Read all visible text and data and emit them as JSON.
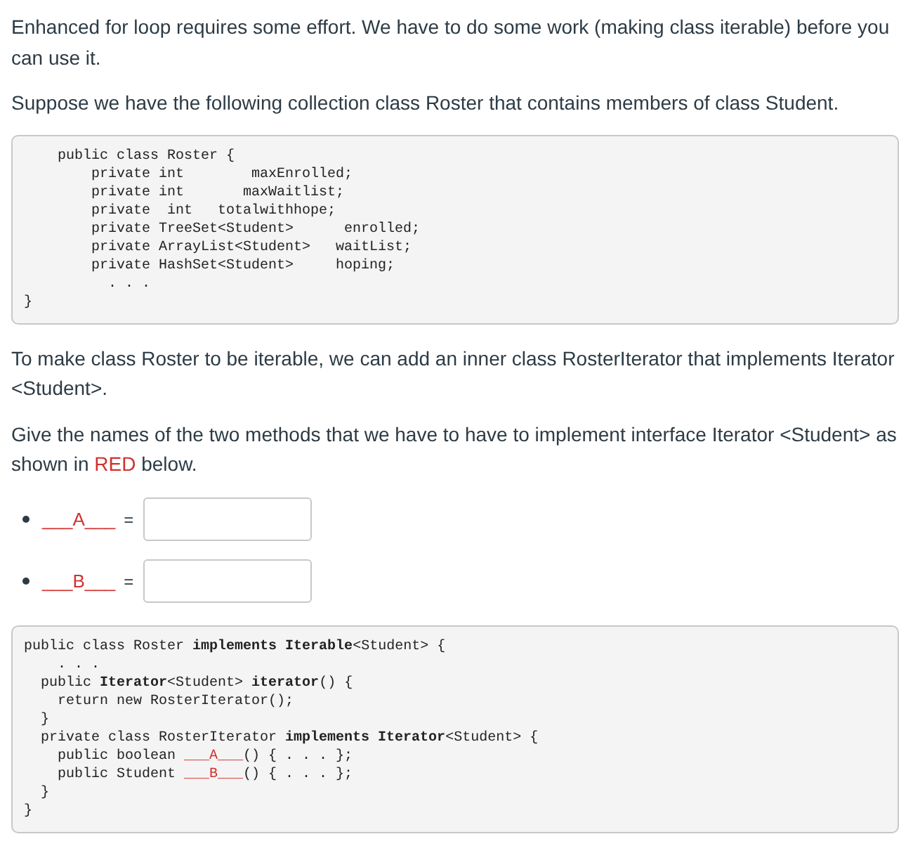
{
  "paragraphs_top": [
    [
      {
        "text": "Enhanced for loop requires some effort. We have to do some work (making class iterable) before you can use it."
      }
    ],
    [
      {
        "text": "Suppose we have the following collection class Roster that contains members of class Student."
      }
    ]
  ],
  "code_block_1": [
    [
      {
        "text": "    public class Roster {"
      }
    ],
    [
      {
        "text": "        private int        maxEnrolled;"
      }
    ],
    [
      {
        "text": "        private int       maxWaitlist;"
      }
    ],
    [
      {
        "text": "        private  int   totalwithhope;"
      }
    ],
    [
      {
        "text": "        private TreeSet<Student>      enrolled;"
      }
    ],
    [
      {
        "text": "        private ArrayList<Student>   waitList;"
      }
    ],
    [
      {
        "text": "        private HashSet<Student>     hoping;"
      }
    ],
    [
      {
        "text": "          . . ."
      }
    ],
    [
      {
        "text": "}"
      }
    ]
  ],
  "paragraphs_middle": [
    [
      {
        "text": "To make class Roster to be iterable, we can add an inner class RosterIterator that implements Iterator <Student>."
      }
    ],
    [
      {
        "text": "Give the names of the two methods that we have to have to implement interface Iterator <Student> as shown in "
      },
      {
        "text": "RED",
        "kind": "red"
      },
      {
        "text": " below."
      }
    ]
  ],
  "answers": [
    {
      "label": "___A___",
      "sign": "="
    },
    {
      "label": "___B___",
      "sign": "="
    }
  ],
  "code_block_2": [
    [
      {
        "text": "public class Roster **implements Iterable**<Student> {"
      }
    ],
    [
      {
        "text": "    . . ."
      }
    ],
    [
      {
        "text": "  public **Iterator**<Student> **iterator**() {"
      }
    ],
    [
      {
        "text": "    return new RosterIterator();"
      }
    ],
    [
      {
        "text": "  }"
      }
    ],
    [
      {
        "text": "  private class RosterIterator **implements Iterator**<Student> {"
      }
    ],
    [
      {
        "text": "    public boolean "
      },
      {
        "text": "___A___",
        "kind": "red"
      },
      {
        "text": "() { . . . };"
      }
    ],
    [
      {
        "text": "    public Student "
      },
      {
        "text": "___B___",
        "kind": "red"
      },
      {
        "text": "() { . . . };"
      }
    ],
    [
      {
        "text": "  }"
      }
    ],
    [
      {
        "text": "}"
      }
    ]
  ]
}
